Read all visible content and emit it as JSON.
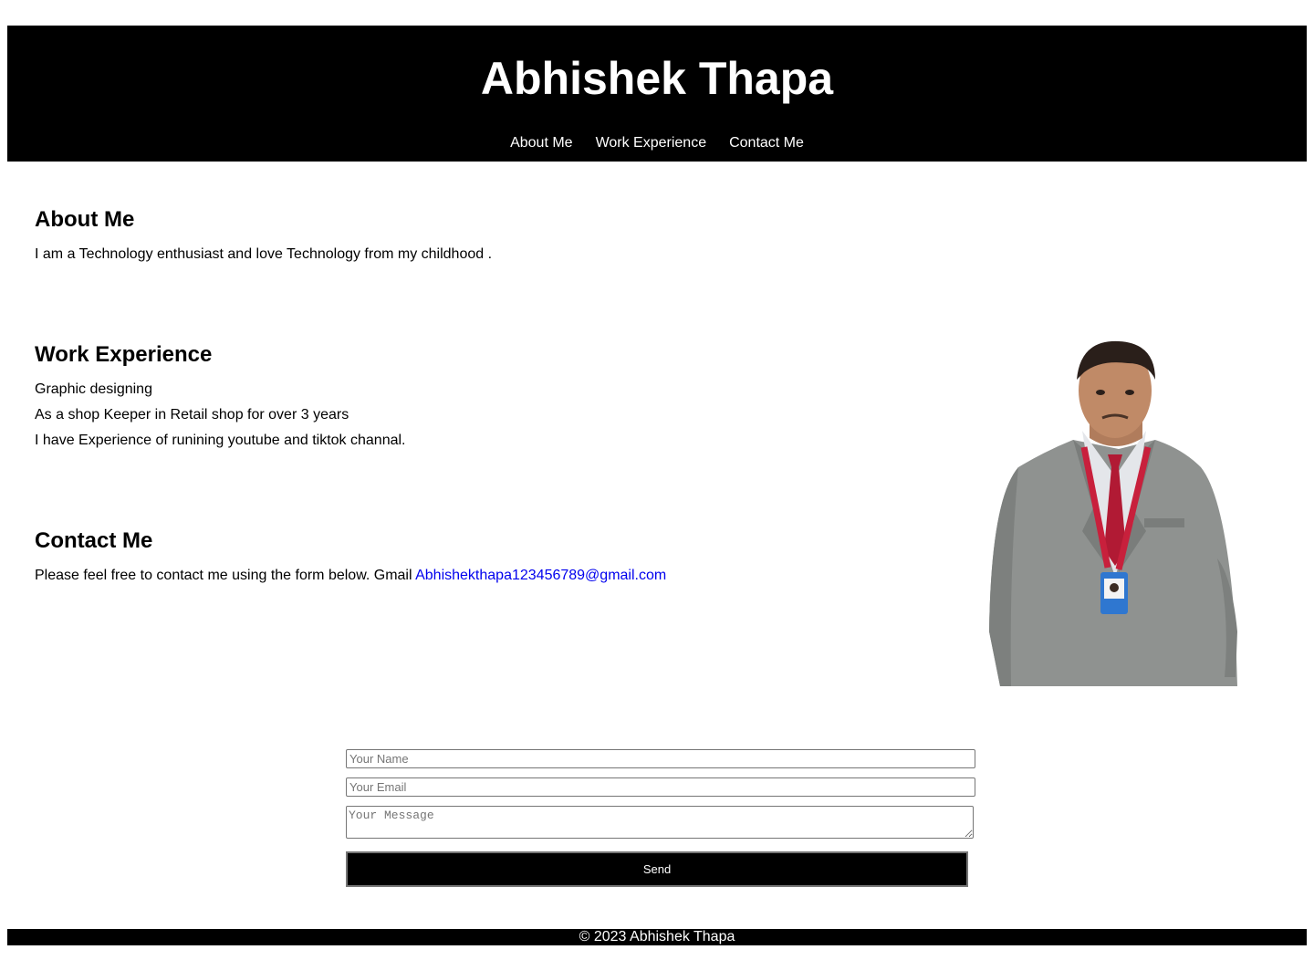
{
  "header": {
    "title": "Abhishek Thapa",
    "nav": [
      "About Me",
      "Work Experience",
      "Contact Me"
    ]
  },
  "about": {
    "heading": "About Me",
    "text": "I am a Technology enthusiast and love Technology from my childhood ."
  },
  "work": {
    "heading": "Work Experience",
    "items": [
      "Graphic designing",
      "As a shop Keeper in Retail shop for over 3 years",
      "I have Experience of runining youtube and tiktok channal."
    ]
  },
  "contact": {
    "heading": "Contact Me",
    "text": "Please feel free to contact me using the form below. Gmail",
    "email": "Abhishekthapa123456789@gmail.com"
  },
  "form": {
    "name_placeholder": "Your Name",
    "email_placeholder": "Your Email",
    "message_placeholder": "Your Message",
    "send_label": "Send"
  },
  "footer": {
    "text": "© 2023 Abhishek Thapa"
  },
  "colors": {
    "header_bg": "#000000",
    "link": "#0000ee"
  }
}
